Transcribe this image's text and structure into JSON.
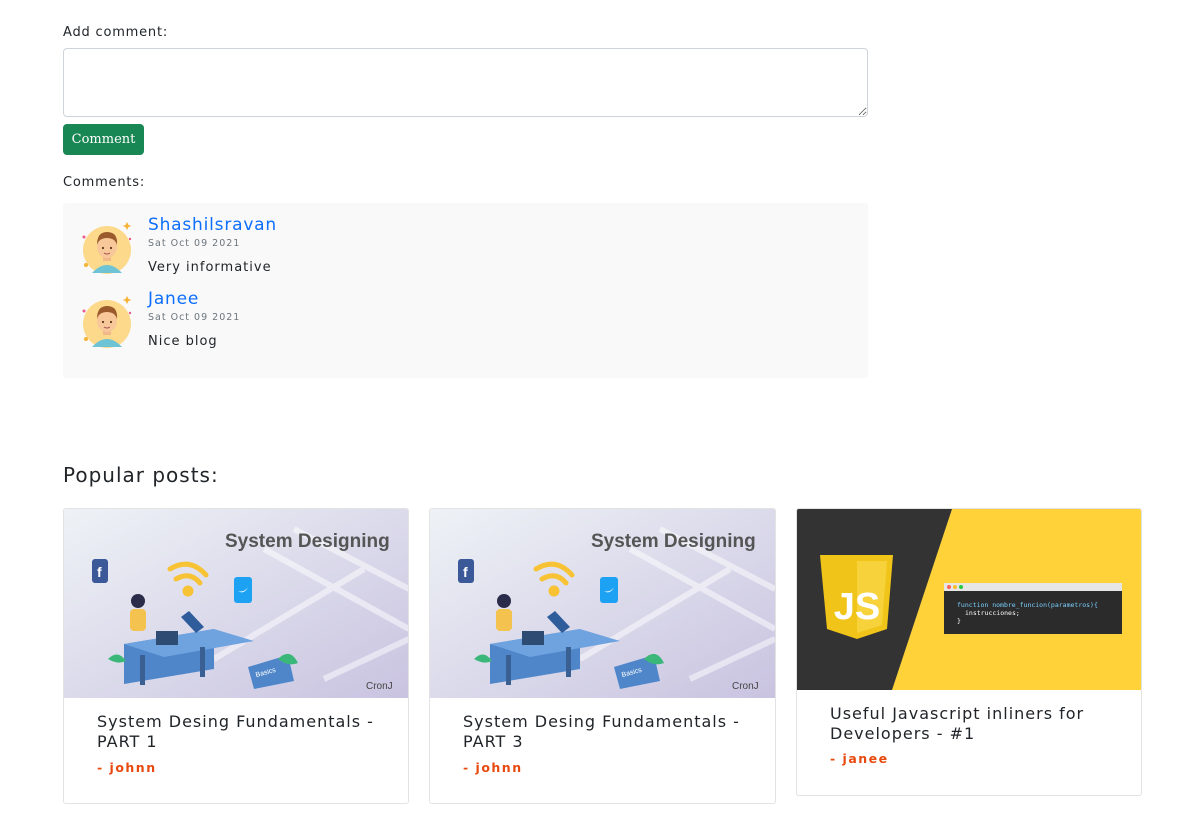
{
  "add_comment": {
    "label": "Add comment:",
    "input_value": "",
    "button_label": "Comment"
  },
  "comments_section": {
    "label": "Comments:",
    "items": [
      {
        "author": "Shashilsravan",
        "date": "Sat Oct 09 2021",
        "text": "Very informative"
      },
      {
        "author": "Janee",
        "date": "Sat Oct 09 2021",
        "text": "Nice blog"
      }
    ]
  },
  "popular": {
    "title": "Popular posts:",
    "posts": [
      {
        "image_heading": "System Designing",
        "image_tag": "Basics",
        "image_brand": "CronJ",
        "title": "System Desing Fundamentals - PART 1",
        "author": "- johnn"
      },
      {
        "image_heading": "System Designing",
        "image_tag": "Basics",
        "image_brand": "CronJ",
        "title": "System Desing Fundamentals - PART 3",
        "author": "- johnn"
      },
      {
        "image_logo": "JS",
        "code_line1": "function nombre_funcion(parametros){",
        "code_line2": "instrucciones;",
        "code_line3": "}",
        "title": "Useful Javascript inliners for Developers - #1",
        "author": "- janee"
      }
    ]
  },
  "colors": {
    "link": "#0d6efd",
    "button": "#198754",
    "author_accent": "#e8490f",
    "js_yellow": "#ffd23a",
    "js_dark": "#333333"
  },
  "icons": [
    "user-avatar-icon",
    "facebook-icon",
    "twitter-icon",
    "wifi-icon"
  ]
}
